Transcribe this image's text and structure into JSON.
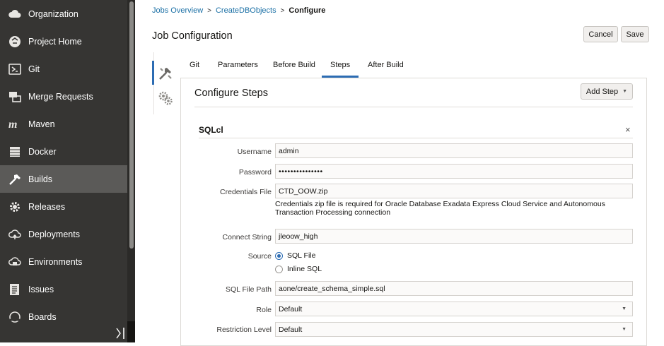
{
  "sidebar": {
    "items": [
      {
        "label": "Organization",
        "icon": "cloud-icon"
      },
      {
        "label": "Project Home",
        "icon": "project-home-icon"
      },
      {
        "label": "Git",
        "icon": "git-icon"
      },
      {
        "label": "Merge Requests",
        "icon": "merge-requests-icon"
      },
      {
        "label": "Maven",
        "icon": "maven-icon"
      },
      {
        "label": "Docker",
        "icon": "docker-icon"
      },
      {
        "label": "Builds",
        "icon": "builds-hammer-icon"
      },
      {
        "label": "Releases",
        "icon": "releases-gear-icon"
      },
      {
        "label": "Deployments",
        "icon": "deployments-cloud-icon"
      },
      {
        "label": "Environments",
        "icon": "environments-icon"
      },
      {
        "label": "Issues",
        "icon": "issues-icon"
      },
      {
        "label": "Boards",
        "icon": "boards-icon"
      }
    ],
    "active": "Builds"
  },
  "breadcrumb": {
    "items": [
      "Jobs Overview",
      "CreateDBObjects",
      "Configure"
    ],
    "separator": ">"
  },
  "page": {
    "title": "Job Configuration",
    "cancel_label": "Cancel",
    "save_label": "Save"
  },
  "vertical_tabs": [
    {
      "icon": "tools-icon",
      "active": true
    },
    {
      "icon": "gears-icon",
      "active": false
    }
  ],
  "tabs": {
    "items": [
      "Git",
      "Parameters",
      "Before Build",
      "Steps",
      "After Build"
    ],
    "active": "Steps"
  },
  "panel": {
    "title": "Configure Steps",
    "add_step_label": "Add Step",
    "add_step_caret": "▼"
  },
  "step": {
    "title": "SQLcl",
    "close": "×",
    "fields": {
      "username": {
        "label": "Username",
        "value": "admin"
      },
      "password": {
        "label": "Password",
        "value": "•••••••••••••••"
      },
      "credentials_file": {
        "label": "Credentials File",
        "value": "CTD_OOW.zip",
        "help": "Credentials zip file is required for Oracle Database Exadata Express Cloud Service and Autonomous Transaction Processing connection"
      },
      "connect_string": {
        "label": "Connect String",
        "value": "jleoow_high"
      },
      "source": {
        "label": "Source",
        "options": [
          "SQL File",
          "Inline SQL"
        ],
        "selected": "SQL File"
      },
      "sql_file_path": {
        "label": "SQL File Path",
        "value": "aone/create_schema_simple.sql"
      },
      "role": {
        "label": "Role",
        "value": "Default"
      },
      "restriction_level": {
        "label": "Restriction Level",
        "value": "Default"
      }
    }
  },
  "colors": {
    "sidebar_bg": "#363533",
    "sidebar_active": "#5b5a58",
    "accent": "#2c6cb3",
    "link": "#1a6fa5"
  }
}
